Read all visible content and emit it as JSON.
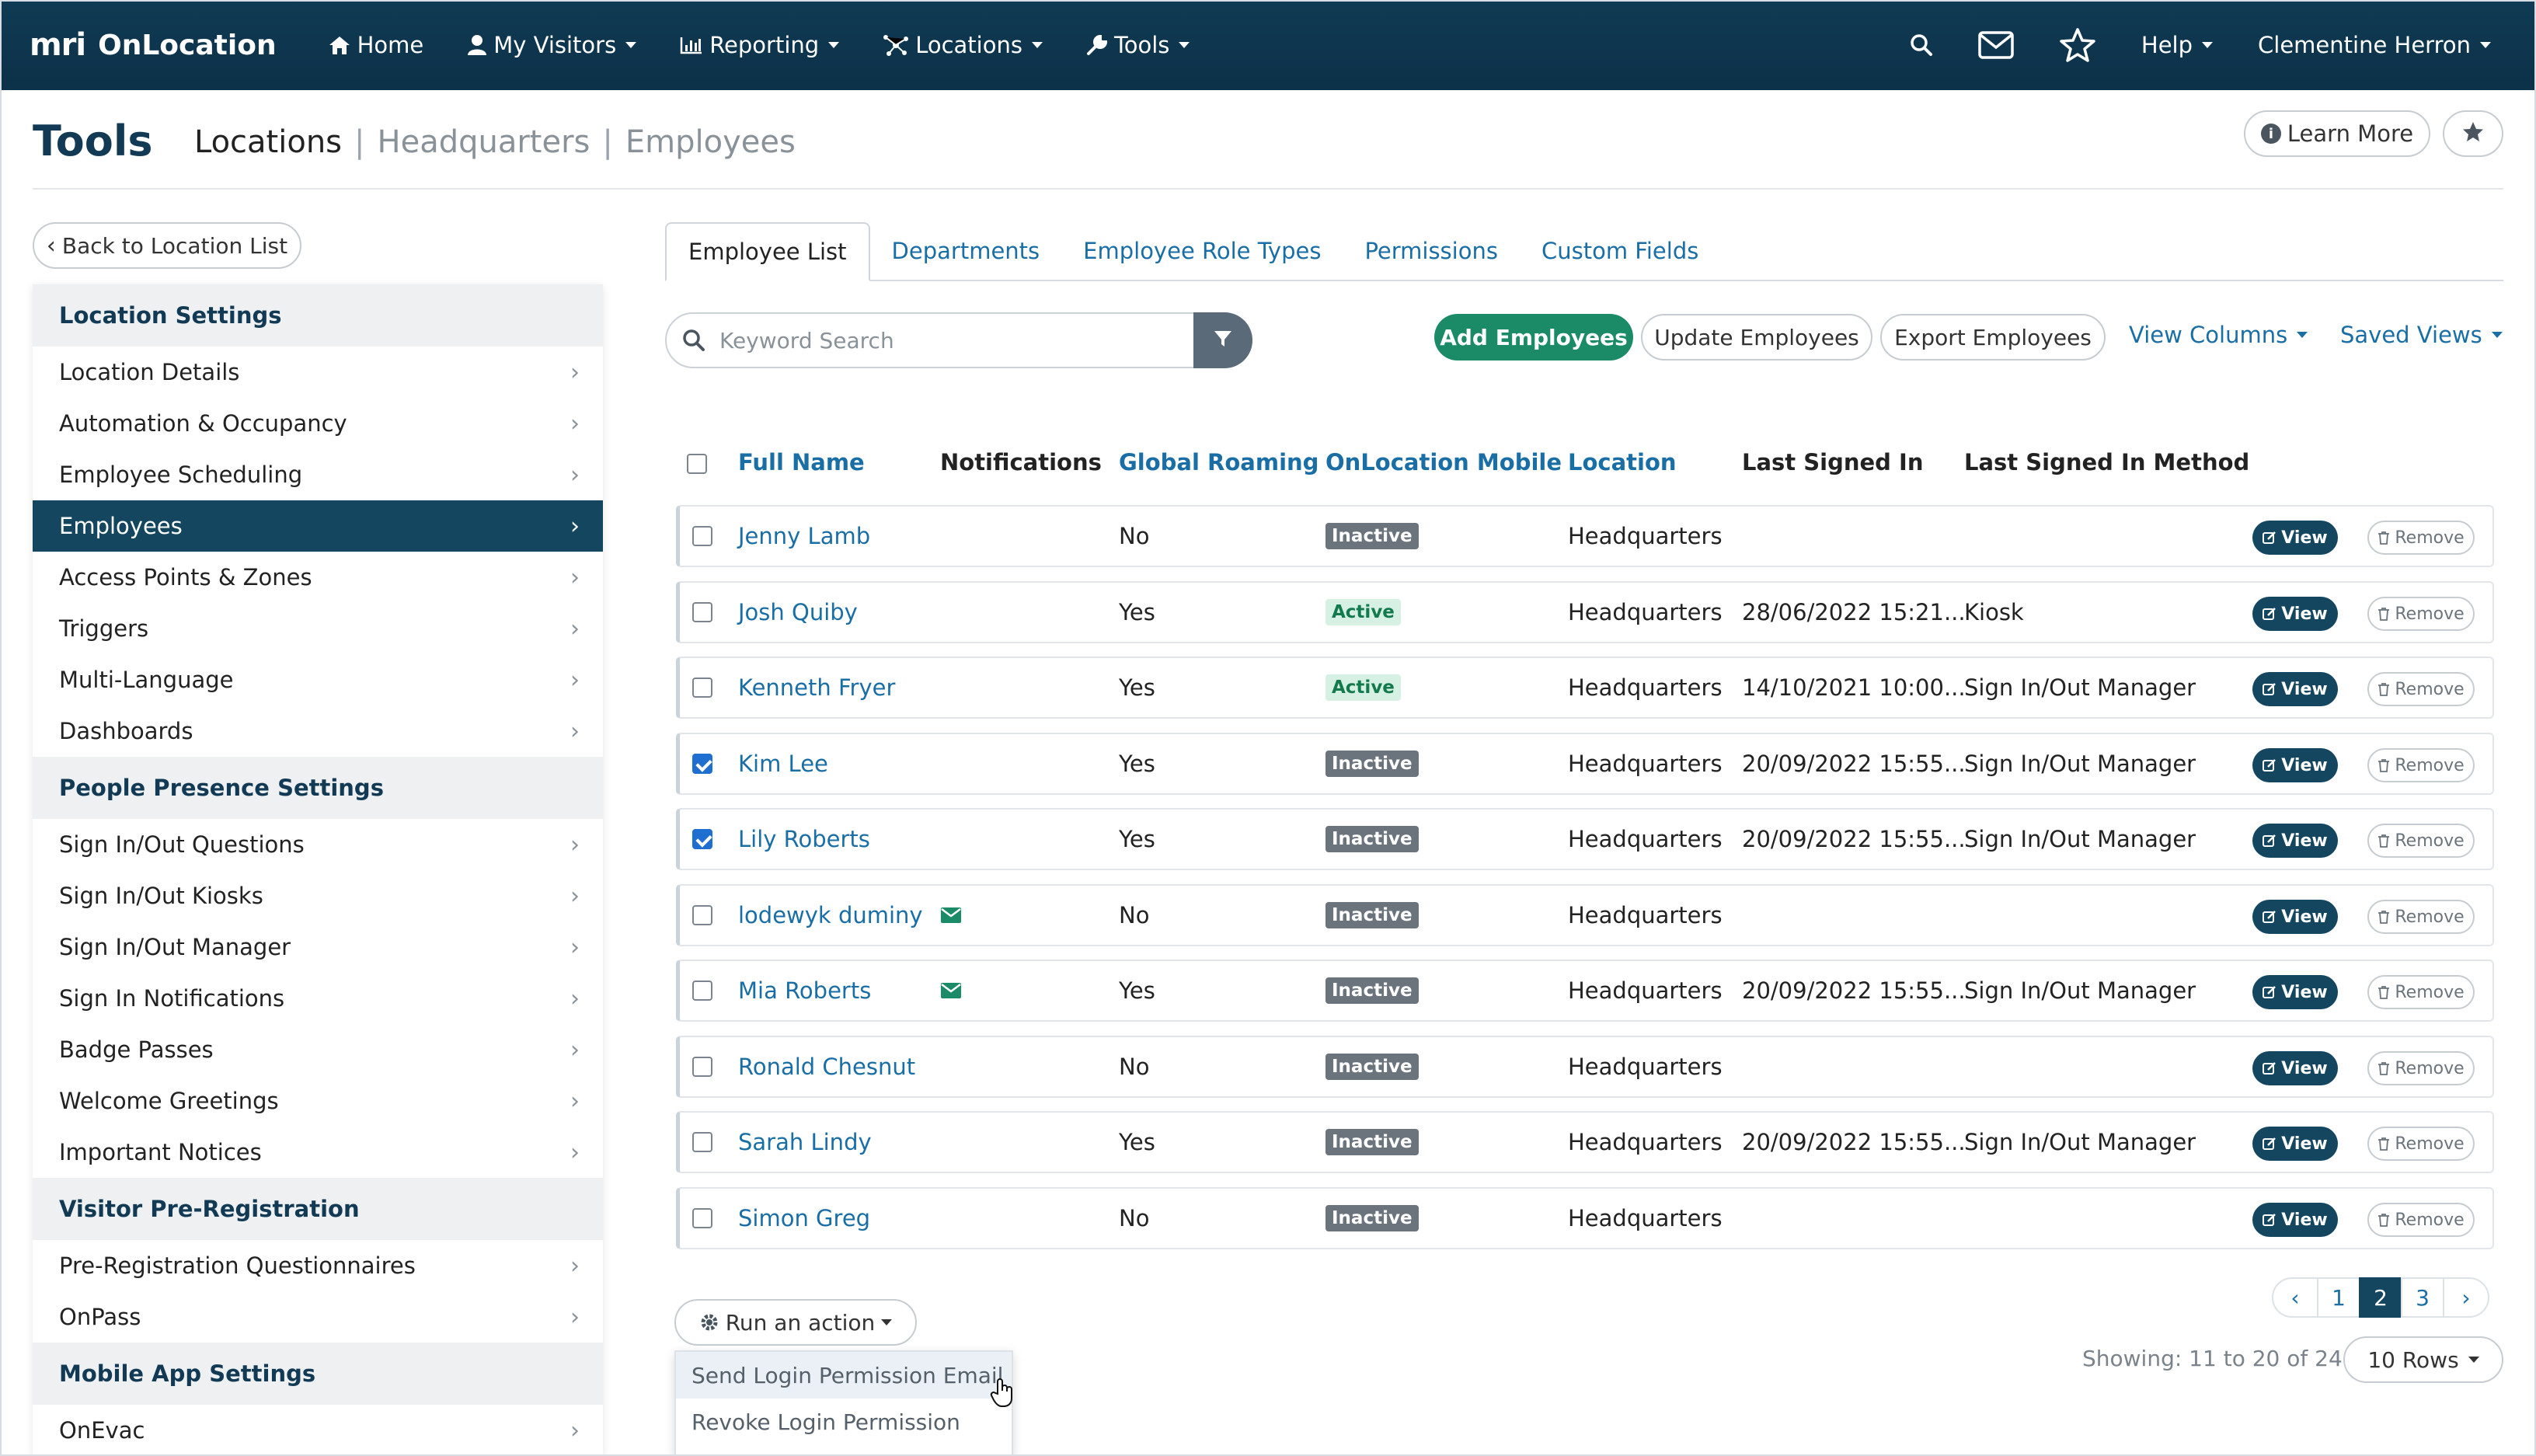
{
  "nav": {
    "brand_logo": "mri",
    "brand_name": "OnLocation",
    "items": [
      {
        "label": "Home",
        "icon": "home-icon"
      },
      {
        "label": "My Visitors",
        "icon": "user-icon"
      },
      {
        "label": "Reporting",
        "icon": "bar-chart-icon"
      },
      {
        "label": "Locations",
        "icon": "network-icon"
      },
      {
        "label": "Tools",
        "icon": "wrench-icon"
      }
    ],
    "help_label": "Help",
    "user_name": "Clementine Herron"
  },
  "header": {
    "title": "Tools",
    "crumb_main": "Locations",
    "crumb_1": "Headquarters",
    "crumb_2": "Employees",
    "sep": "|",
    "learn_more": "Learn More"
  },
  "sidebar": {
    "back_label": "Back to Location List",
    "sections": [
      {
        "title": "Location Settings",
        "items": [
          "Location Details",
          "Automation & Occupancy",
          "Employee Scheduling",
          "Employees",
          "Access Points & Zones",
          "Triggers",
          "Multi-Language",
          "Dashboards"
        ]
      },
      {
        "title": "People Presence Settings",
        "items": [
          "Sign In/Out Questions",
          "Sign In/Out Kiosks",
          "Sign In/Out Manager",
          "Sign In Notifications",
          "Badge Passes",
          "Welcome Greetings",
          "Important Notices"
        ]
      },
      {
        "title": "Visitor Pre-Registration",
        "items": [
          "Pre-Registration Questionnaires",
          "OnPass"
        ]
      },
      {
        "title": "Mobile App Settings",
        "items": [
          "OnEvac"
        ]
      }
    ],
    "active_item": "Employees"
  },
  "tabs": [
    "Employee List",
    "Departments",
    "Employee Role Types",
    "Permissions",
    "Custom Fields"
  ],
  "active_tab": "Employee List",
  "toolbar": {
    "search_placeholder": "Keyword Search",
    "add_employees": "Add Employees",
    "update_employees": "Update Employees",
    "export_employees": "Export Employees",
    "view_columns": "View Columns",
    "saved_views": "Saved Views"
  },
  "table": {
    "columns": [
      "Full Name",
      "Notifications",
      "Global Roaming",
      "OnLocation Mobile",
      "Location",
      "Last Signed In",
      "Last Signed In Method"
    ],
    "view_label": "View",
    "remove_label": "Remove",
    "rows": [
      {
        "name": "Jenny Lamb",
        "notify": false,
        "roaming": "No",
        "mobile": "Inactive",
        "location": "Headquarters",
        "last_signed": "",
        "method": "",
        "checked": false
      },
      {
        "name": "Josh Quiby",
        "notify": false,
        "roaming": "Yes",
        "mobile": "Active",
        "location": "Headquarters",
        "last_signed": "28/06/2022 15:21...",
        "method": "Kiosk",
        "checked": false
      },
      {
        "name": "Kenneth Fryer",
        "notify": false,
        "roaming": "Yes",
        "mobile": "Active",
        "location": "Headquarters",
        "last_signed": "14/10/2021 10:00...",
        "method": "Sign In/Out Manager",
        "checked": false
      },
      {
        "name": "Kim Lee",
        "notify": false,
        "roaming": "Yes",
        "mobile": "Inactive",
        "location": "Headquarters",
        "last_signed": "20/09/2022 15:55...",
        "method": "Sign In/Out Manager",
        "checked": true
      },
      {
        "name": "Lily Roberts",
        "notify": false,
        "roaming": "Yes",
        "mobile": "Inactive",
        "location": "Headquarters",
        "last_signed": "20/09/2022 15:55...",
        "method": "Sign In/Out Manager",
        "checked": true
      },
      {
        "name": "lodewyk duminy",
        "notify": true,
        "roaming": "No",
        "mobile": "Inactive",
        "location": "Headquarters",
        "last_signed": "",
        "method": "",
        "checked": false
      },
      {
        "name": "Mia Roberts",
        "notify": true,
        "roaming": "Yes",
        "mobile": "Inactive",
        "location": "Headquarters",
        "last_signed": "20/09/2022 15:55...",
        "method": "Sign In/Out Manager",
        "checked": false
      },
      {
        "name": "Ronald Chesnut",
        "notify": false,
        "roaming": "No",
        "mobile": "Inactive",
        "location": "Headquarters",
        "last_signed": "",
        "method": "",
        "checked": false
      },
      {
        "name": "Sarah Lindy",
        "notify": false,
        "roaming": "Yes",
        "mobile": "Inactive",
        "location": "Headquarters",
        "last_signed": "20/09/2022 15:55...",
        "method": "Sign In/Out Manager",
        "checked": false
      },
      {
        "name": "Simon Greg",
        "notify": false,
        "roaming": "No",
        "mobile": "Inactive",
        "location": "Headquarters",
        "last_signed": "",
        "method": "",
        "checked": false
      }
    ]
  },
  "actions": {
    "run_action": "Run an action",
    "menu": [
      "Send Login Permission Email",
      "Revoke Login Permission"
    ]
  },
  "pagination": {
    "pages": [
      "1",
      "2",
      "3"
    ],
    "current_page": "2",
    "showing": "Showing: 11 to 20 of 24",
    "rows_label": "10 Rows"
  },
  "colors": {
    "nav_bg": "#0c3148",
    "active_bg": "#14465f",
    "link": "#1a6ea6",
    "green": "#1a8b66",
    "inactive": "#6b747c"
  }
}
